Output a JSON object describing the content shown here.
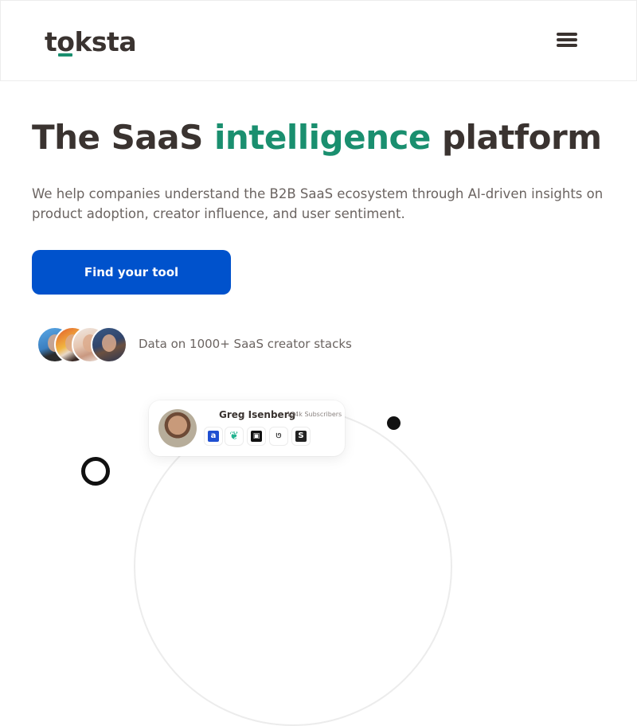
{
  "header": {
    "logo_pre": "t",
    "logo_o": "o",
    "logo_post": "ksta",
    "menu_icon": "hamburger-menu-icon"
  },
  "hero": {
    "title_pre": "The SaaS ",
    "title_accent": "intelligence",
    "title_post": " platform",
    "subtitle": "We help companies understand the B2B SaaS ecosystem through AI-driven insights on product adoption, creator influence, and user sentiment.",
    "cta_label": "Find your tool",
    "social_proof": "Data on 1000+ SaaS creator stacks"
  },
  "creator_card": {
    "name": "Greg Isenberg",
    "subscribers": "124k Subscribers",
    "tools": [
      {
        "icon": "tool-a-icon",
        "glyph": "a"
      },
      {
        "icon": "tool-leaf-icon",
        "glyph": "❦"
      },
      {
        "icon": "tool-cube-icon",
        "glyph": "▣"
      },
      {
        "icon": "tool-logo-icon",
        "glyph": "ᘎ"
      },
      {
        "icon": "tool-s-icon",
        "glyph": "S"
      }
    ]
  },
  "colors": {
    "accent": "#1a8f6f",
    "primary_button": "#0052cc",
    "text": "#3a3330"
  }
}
